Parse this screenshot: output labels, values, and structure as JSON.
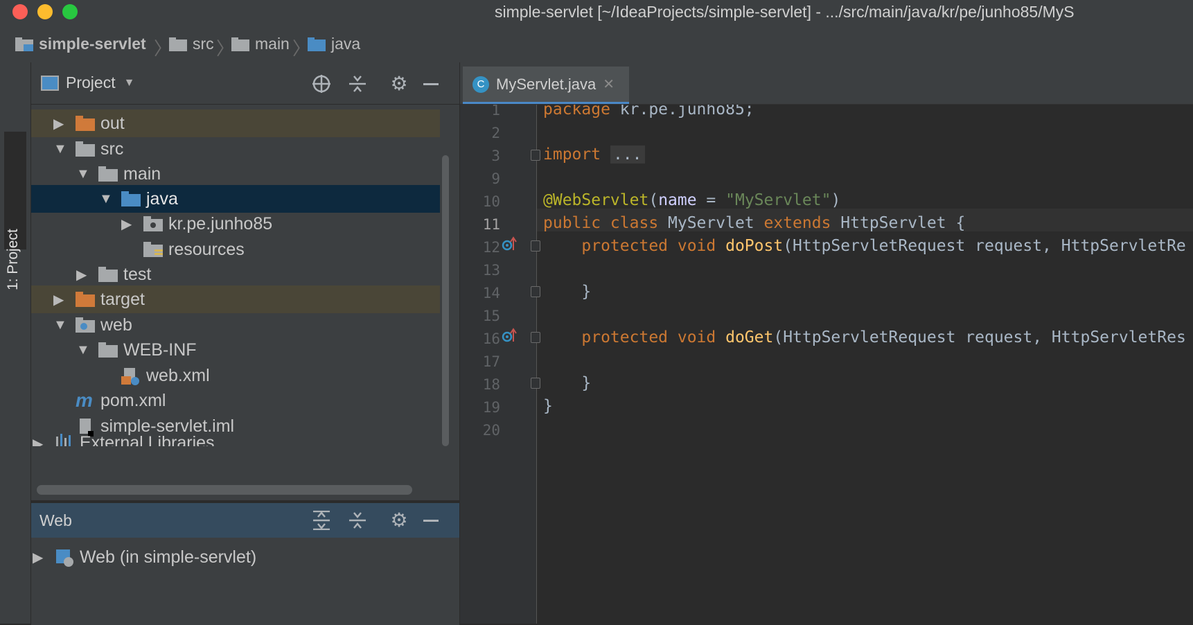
{
  "window": {
    "title": "simple-servlet [~/IdeaProjects/simple-servlet] - .../src/main/java/kr/pe/junho85/MyS"
  },
  "breadcrumbs": [
    "simple-servlet",
    "src",
    "main",
    "java"
  ],
  "tool_strip": {
    "project_label": "1: Project"
  },
  "project_panel": {
    "title": "Project",
    "tree": [
      {
        "label": "out",
        "expanded": false,
        "kind": "folder-excluded"
      },
      {
        "label": "src",
        "expanded": true,
        "kind": "folder"
      },
      {
        "label": "main",
        "expanded": true,
        "kind": "folder"
      },
      {
        "label": "java",
        "expanded": true,
        "kind": "source-root",
        "selected": true
      },
      {
        "label": "kr.pe.junho85",
        "expanded": false,
        "kind": "package"
      },
      {
        "label": "resources",
        "kind": "resources-root"
      },
      {
        "label": "test",
        "expanded": false,
        "kind": "folder"
      },
      {
        "label": "target",
        "expanded": false,
        "kind": "folder-excluded"
      },
      {
        "label": "web",
        "expanded": true,
        "kind": "web-root"
      },
      {
        "label": "WEB-INF",
        "expanded": true,
        "kind": "folder"
      },
      {
        "label": "web.xml",
        "kind": "xml-file"
      },
      {
        "label": "pom.xml",
        "kind": "maven-file"
      },
      {
        "label": "simple-servlet.iml",
        "kind": "iml-file"
      },
      {
        "label": "External Libraries",
        "expanded": false,
        "kind": "libraries"
      }
    ]
  },
  "web_panel": {
    "title": "Web",
    "items": [
      {
        "label": "Web (in simple-servlet)"
      }
    ]
  },
  "editor": {
    "tab": {
      "label": "MyServlet.java",
      "icon_letter": "C"
    },
    "line_numbers": [
      "1",
      "2",
      "3",
      "9",
      "10",
      "11",
      "12",
      "13",
      "14",
      "15",
      "16",
      "17",
      "18",
      "19",
      "20"
    ],
    "current_line": "11",
    "code": {
      "l1_kw": "package",
      "l1_rest": " kr.pe.junho85;",
      "l3_kw": "import",
      "l3_folded": "...",
      "l10_ann": "@WebServlet",
      "l10_open": "(",
      "l10_param": "name",
      "l10_eq": " = ",
      "l10_str": "\"MyServlet\"",
      "l10_close": ")",
      "l11_kw": "public class",
      "l11_name": " MyServlet ",
      "l11_kw2": "extends",
      "l11_rest": " HttpServlet {",
      "l12_kw": "    protected void",
      "l12_fn": " doPost",
      "l12_rest": "(HttpServletRequest request,",
      "l12_rest2": " HttpServletRe",
      "l14": "    }",
      "l16_kw": "    protected void",
      "l16_fn": " doGet",
      "l16_rest": "(HttpServletRequest request,",
      "l16_rest2": " HttpServletRes",
      "l18": "    }",
      "l19": "}"
    }
  },
  "colors": {
    "accent": "#4a88c7",
    "selection": "#0d293e",
    "excluded_row": "#4a4637"
  }
}
